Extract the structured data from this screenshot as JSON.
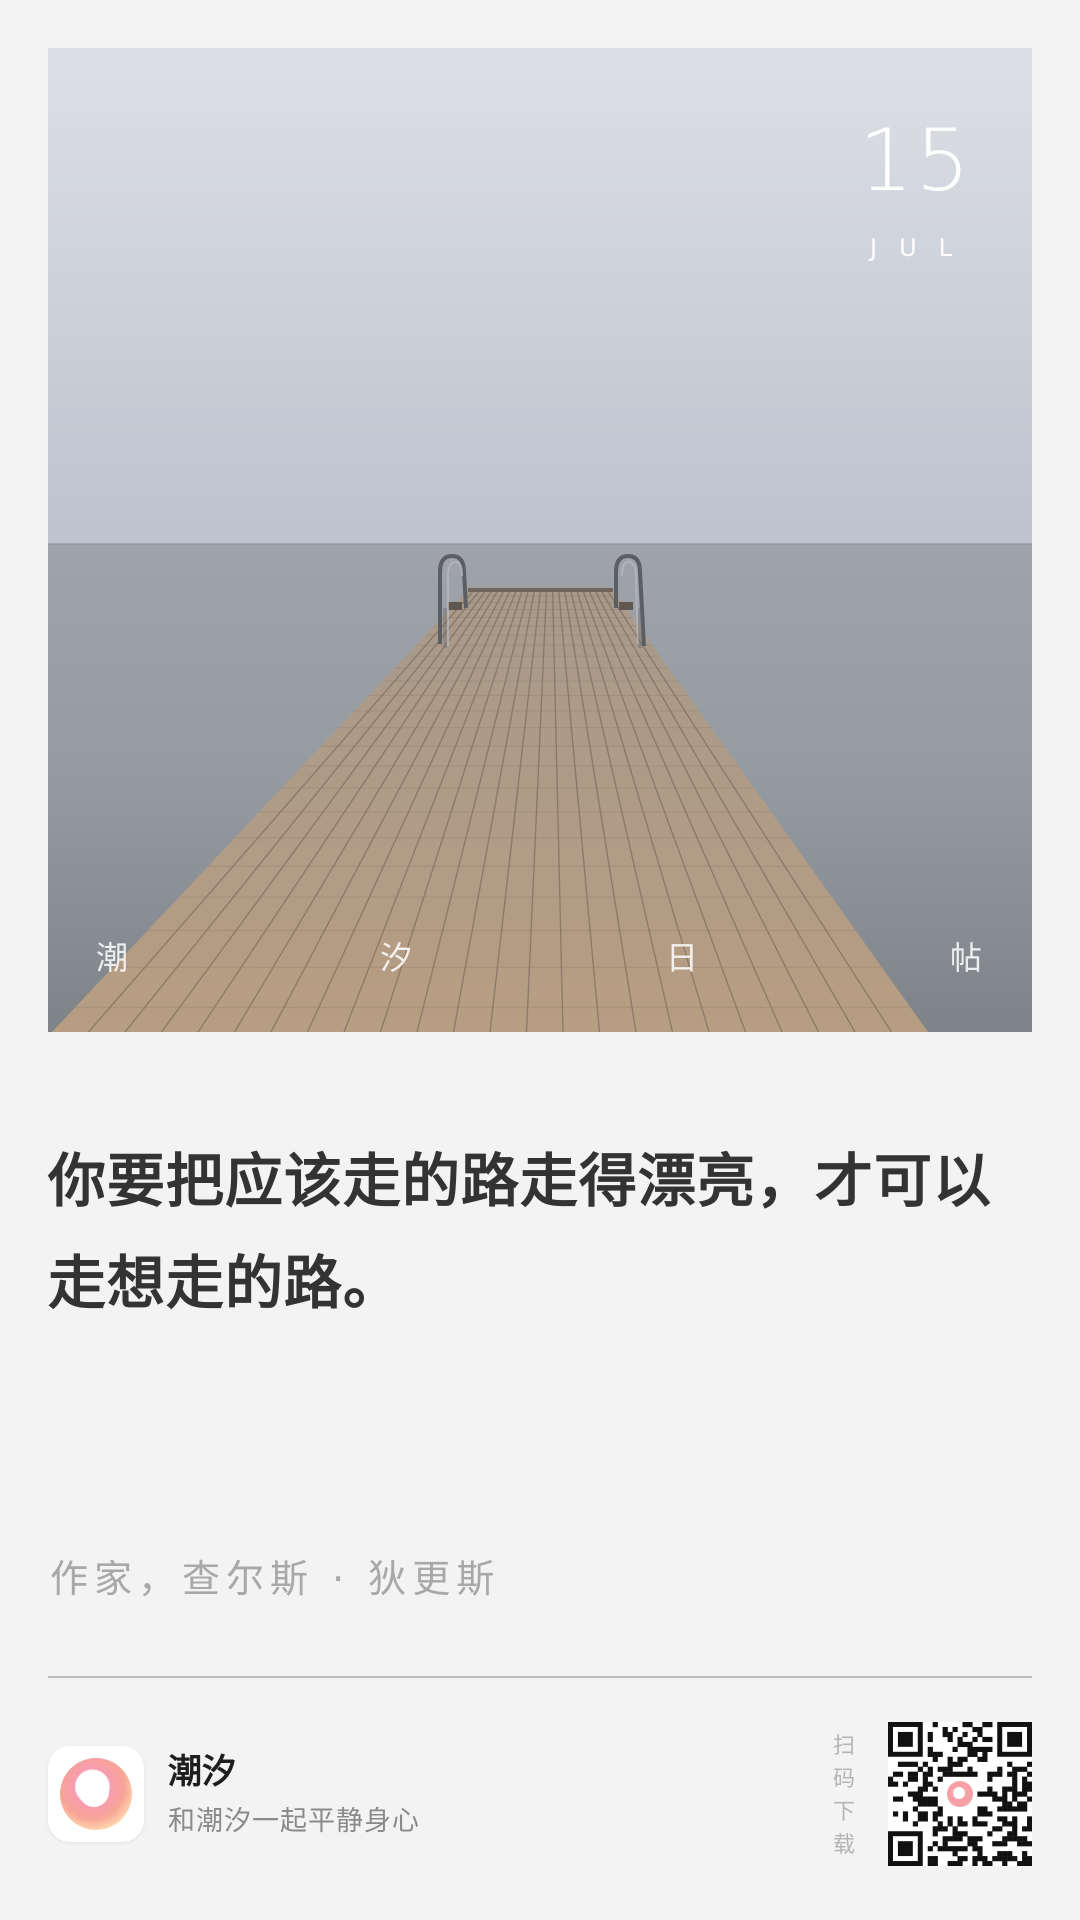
{
  "card": {
    "date_day": "15",
    "date_month": "JUL",
    "brand_chars": [
      "潮",
      "汐",
      "日",
      "帖"
    ]
  },
  "quote": {
    "text": "你要把应该走的路走得漂亮，才可以走想走的路。",
    "author": "作家，查尔斯 · 狄更斯"
  },
  "footer": {
    "app_name": "潮汐",
    "app_slogan": "和潮汐一起平静身心",
    "scan_label": "扫码下载",
    "icon": "tide-app-icon",
    "qr_icon": "qr-code-icon"
  },
  "colors": {
    "background": "#f3f3f3",
    "quote_text": "#333333",
    "muted_text": "#a8a8a8",
    "icon_gradient_outer": "#f48ba2",
    "icon_gradient_inner": "#ffd6a8"
  }
}
